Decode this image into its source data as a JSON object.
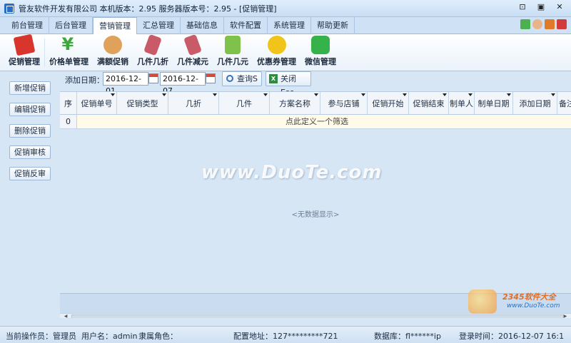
{
  "window": {
    "title": "管友软件开发有限公司 本机版本：2.95 服务器版本号：2.95 - [促销管理]",
    "controls": [
      "⊡",
      "▣",
      "✕"
    ]
  },
  "tabs": [
    {
      "label": "前台管理",
      "active": false
    },
    {
      "label": "后台管理",
      "active": false
    },
    {
      "label": "营销管理",
      "active": true
    },
    {
      "label": "汇总管理",
      "active": false
    },
    {
      "label": "基础信息",
      "active": false
    },
    {
      "label": "软件配置",
      "active": false
    },
    {
      "label": "系统管理",
      "active": false
    },
    {
      "label": "帮助更新",
      "active": false
    }
  ],
  "toolbar": [
    {
      "label": "促销管理",
      "icon": "sale-tag-icon"
    },
    {
      "label": "价格单管理",
      "icon": "yen-icon"
    },
    {
      "label": "满额促销",
      "icon": "money-bag-icon"
    },
    {
      "label": "几件几折",
      "icon": "discount-tag-icon"
    },
    {
      "label": "几件减元",
      "icon": "reduce-tag-icon"
    },
    {
      "label": "几件几元",
      "icon": "shopping-bag-icon"
    },
    {
      "label": "优惠券管理",
      "icon": "coupon-icon"
    },
    {
      "label": "微信管理",
      "icon": "wechat-icon"
    }
  ],
  "sidebar": {
    "buttons": [
      "新增促销",
      "编辑促销",
      "删除促销",
      "促销审核",
      "促销反审"
    ]
  },
  "filter": {
    "date_label": "添加日期：",
    "date_from": "2016-12-01",
    "date_to": "2016-12-07",
    "search_label": "查询S",
    "close_label": "关闭Esc"
  },
  "grid": {
    "columns": [
      "序",
      "促销单号",
      "促销类型",
      "几折",
      "几件",
      "方案名称",
      "参与店铺",
      "促销开始",
      "促销结束",
      "制单人",
      "制单日期",
      "添加日期",
      "备注"
    ],
    "row_index": "0",
    "filter_row_text": "点此定义一个筛选",
    "empty_text": "<无数据显示>"
  },
  "watermark": {
    "text": "www.DuoTe.com",
    "corner_title": "2345软件大全",
    "corner_url": "www.DuoTe.com"
  },
  "status": {
    "operator": "当前操作员：管理员",
    "username": "用户名：admin",
    "role": "隶属角色：",
    "server": "配置地址：127*********721",
    "database": "数据库：fl******ip",
    "login_time": "登录时间：2016-12-07 16:1"
  }
}
